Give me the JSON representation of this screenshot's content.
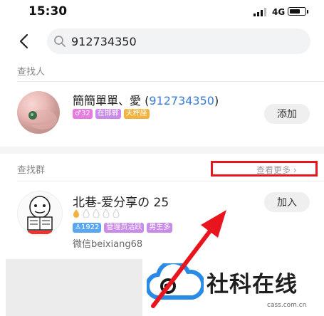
{
  "status_bar": {
    "time": "15:30",
    "network": "4G",
    "battery_level": 0.7
  },
  "search": {
    "query": "912734350",
    "placeholder": ""
  },
  "person_section": {
    "label": "查找人",
    "result": {
      "name_prefix": "簡簡單單、愛 (",
      "name_highlight": "912734350",
      "name_suffix": ")",
      "tags": [
        {
          "text": "♂32",
          "color": "#e67be0"
        },
        {
          "text": "在邯郸",
          "color": "#c98be8"
        },
        {
          "text": "天秤座",
          "color": "#f2b33d"
        }
      ],
      "action_label": "添加"
    }
  },
  "group_section": {
    "label": "查找群",
    "see_more": "查看更多 ›",
    "result": {
      "name": "北巷-爱分享の 25",
      "tags": [
        {
          "text": "♙1922",
          "color": "#5aa7f0"
        },
        {
          "text": "管理员活跃",
          "color": "#c98be8"
        },
        {
          "text": "男生多",
          "color": "#c98be8"
        }
      ],
      "description": "微信beixiang68",
      "action_label": "加入"
    }
  },
  "watermark": {
    "text": "社科在线",
    "domain": "cass.com.cn"
  },
  "colors": {
    "highlight": "#3a7bd5",
    "annotation_red": "#e8141e",
    "watermark_blue": "#2a8be6"
  }
}
